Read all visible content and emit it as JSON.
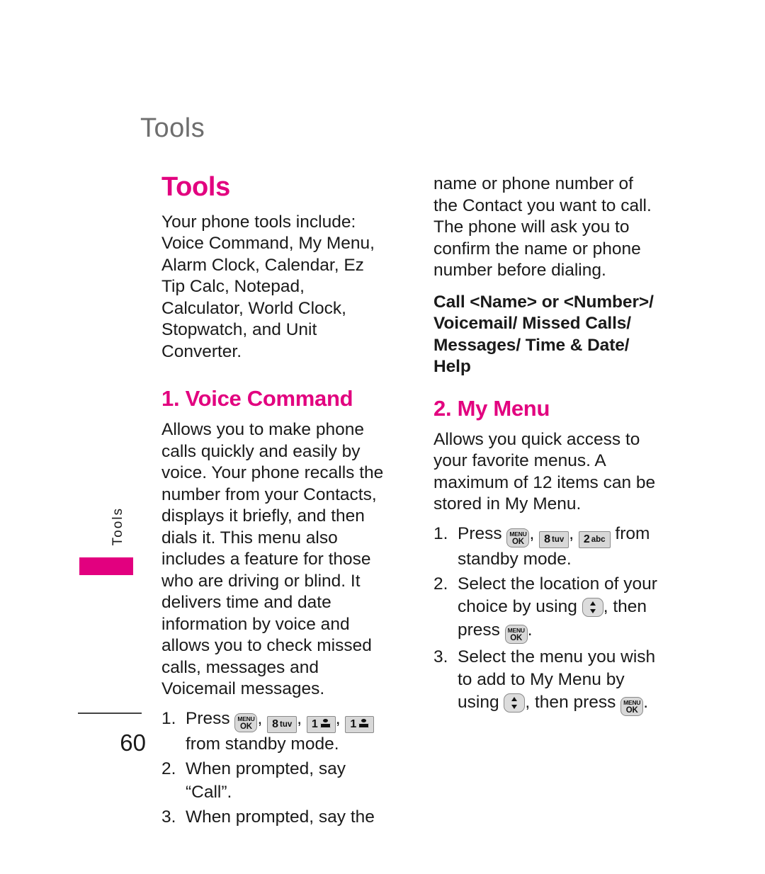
{
  "page": {
    "running_header": "Tools",
    "side_tab_label": "Tools",
    "page_number": "60",
    "accent_color": "#e2007f",
    "header_color": "#6e6e6e"
  },
  "left_column": {
    "section_title": "Tools",
    "intro": "Your phone tools include: Voice Command, My Menu, Alarm Clock, Calendar, Ez Tip Calc, Notepad, Calculator, World Clock, Stopwatch, and Unit Converter.",
    "subsection_title": "1. Voice Command",
    "subsection_body": "Allows you to make phone calls quickly and easily by voice. Your phone recalls the number from your Contacts, displays it briefly, and then dials it. This menu also includes a feature for those who are driving or blind. It delivers time and date information by voice and allows you to check missed calls, messages and Voicemail messages.",
    "steps": [
      {
        "num": "1.",
        "before": "Press",
        "keys": [
          "menu-ok-key",
          "8-tuv-key",
          "1-voicemail-key",
          "1-voicemail-key"
        ],
        "after": "from standby mode."
      },
      {
        "num": "2.",
        "text": "When prompted, say “Call”."
      },
      {
        "num": "3.",
        "text": "When prompted, say the"
      }
    ]
  },
  "right_column": {
    "continued_body": "name or phone number of the Contact you want to call. The phone will ask you to confirm the name or phone number before dialing.",
    "bold_list": "Call <Name> or <Number>/ Voicemail/ Missed Calls/ Messages/ Time & Date/ Help",
    "subsection_title": "2. My Menu",
    "subsection_body": "Allows you quick access to your favorite menus. A maximum of 12 items can be stored in My Menu.",
    "steps": [
      {
        "num": "1.",
        "before": "Press",
        "keys": [
          "menu-ok-key",
          "8-tuv-key",
          "2-abc-key"
        ],
        "after": "from standby mode."
      },
      {
        "num": "2.",
        "before": "Select the location of your choice by using",
        "keys": [
          "nav-up-down-key"
        ],
        "mid": ", then press",
        "keys2": [
          "menu-ok-key"
        ],
        "after": "."
      },
      {
        "num": "3.",
        "before": "Select the menu you wish to add to My Menu by using",
        "keys": [
          "nav-up-down-key"
        ],
        "mid": ", then press",
        "keys2": [
          "menu-ok-key"
        ],
        "after": "."
      }
    ]
  },
  "keys": {
    "menu_ok": {
      "line1": "MENU",
      "line2": "OK"
    },
    "eight_tuv": {
      "digit": "8",
      "letters": "tuv"
    },
    "two_abc": {
      "digit": "2",
      "letters": "abc"
    },
    "one_voicemail": {
      "digit": "1",
      "letters": ""
    }
  }
}
